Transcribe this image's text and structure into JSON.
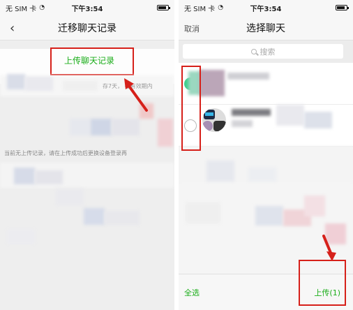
{
  "left_screen": {
    "status": {
      "carrier": "无 SIM 卡",
      "wifi": "wifi-icon",
      "time": "下午3:54"
    },
    "nav": {
      "title": "迁移聊天记录",
      "back_icon": "chevron-left-icon"
    },
    "upload_link": "上传聊天记录",
    "hint_fragment": "存7天，    在有效期内",
    "status_note": "当前无上传记录，请在上传成功后更换设备登录再"
  },
  "right_screen": {
    "status": {
      "carrier": "无 SIM 卡",
      "wifi": "wifi-icon",
      "time": "下午3:54"
    },
    "nav": {
      "title": "选择聊天",
      "cancel": "取消"
    },
    "search": {
      "placeholder": "搜索",
      "icon": "search-icon"
    },
    "chats": [
      {
        "selected": true
      },
      {
        "selected": false
      }
    ],
    "bottom": {
      "select_all": "全选",
      "upload": "上传(1)"
    }
  },
  "colors": {
    "accent_green": "#1aad19",
    "annotation_red": "#d6201a",
    "checked_green": "#3fcf8e"
  }
}
